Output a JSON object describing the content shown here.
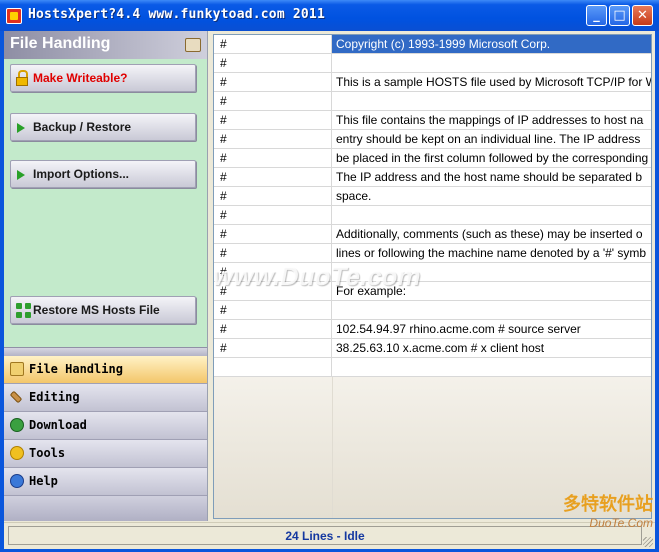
{
  "window": {
    "title": "HostsXpert?4.4  www.funkytoad.com 2011",
    "controls": {
      "minimize": "_",
      "maximize": "□",
      "close": "✕"
    }
  },
  "left_panel": {
    "header": "File Handling",
    "header_icon": "folder-edit-icon",
    "actions": [
      {
        "label": "Make Writeable?",
        "icon": "lock-icon"
      },
      {
        "label": "Backup / Restore",
        "icon": "green-arrow-icon"
      },
      {
        "label": "Import Options...",
        "icon": "green-arrow-icon"
      },
      {
        "label": "Restore MS Hosts File",
        "icon": "restore-icon"
      }
    ],
    "nav": [
      {
        "label": "File Handling",
        "icon": "file-handling-icon",
        "active": true
      },
      {
        "label": "Editing",
        "icon": "wrench-icon",
        "active": false
      },
      {
        "label": "Download",
        "icon": "download-icon",
        "active": false
      },
      {
        "label": "Tools",
        "icon": "tools-icon",
        "active": false
      },
      {
        "label": "Help",
        "icon": "help-icon",
        "active": false
      }
    ]
  },
  "hosts_grid": {
    "rows": [
      {
        "c1": "#",
        "c2": "Copyright (c) 1993-1999 Microsoft Corp.",
        "selected": true
      },
      {
        "c1": "#",
        "c2": ""
      },
      {
        "c1": "#",
        "c2": "This is a sample HOSTS file used by Microsoft TCP/IP for W"
      },
      {
        "c1": "#",
        "c2": ""
      },
      {
        "c1": "#",
        "c2": "This file contains the mappings of IP addresses to host na"
      },
      {
        "c1": "#",
        "c2": "entry should be kept on an individual line. The IP address"
      },
      {
        "c1": "#",
        "c2": "be placed in the first column followed by the corresponding"
      },
      {
        "c1": "#",
        "c2": "The IP address and the host name should be separated b"
      },
      {
        "c1": "#",
        "c2": "space."
      },
      {
        "c1": "#",
        "c2": ""
      },
      {
        "c1": "#",
        "c2": "Additionally, comments (such as these) may be inserted o"
      },
      {
        "c1": "#",
        "c2": "lines or following the machine name denoted by a '#' symb"
      },
      {
        "c1": "#",
        "c2": ""
      },
      {
        "c1": "#",
        "c2": "For example:"
      },
      {
        "c1": "#",
        "c2": ""
      },
      {
        "c1": "#",
        "c2": "102.54.94.97     rhino.acme.com          # source server"
      },
      {
        "c1": "#",
        "c2": "38.25.63.10     x.acme.com              # x client host"
      },
      {
        "c1": "",
        "c2": ""
      }
    ]
  },
  "watermark": {
    "text": "www.DuoTe.com",
    "corner_main": "多特软件站",
    "corner_sub": "DuoTe.Com"
  },
  "status": {
    "text": "24 Lines - Idle"
  }
}
